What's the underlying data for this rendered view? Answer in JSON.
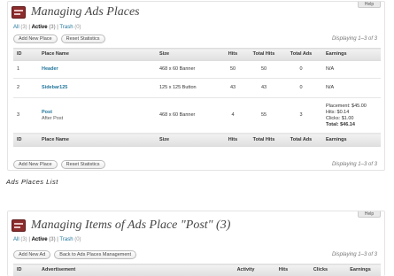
{
  "panel1": {
    "help": "Help",
    "title": "Managing Ads Places",
    "filters": {
      "all_label": "All",
      "all_count": "(3)",
      "active_label": "Active",
      "active_count": "(3)",
      "trash_label": "Trash",
      "trash_count": "(0)",
      "sep": "|"
    },
    "toolbar": {
      "add_label": "Add New Place",
      "reset_label": "Reset Statistics"
    },
    "displaying": "Displaying 1–3 of 3",
    "columns": {
      "id": "ID",
      "place": "Place Name",
      "size": "Size",
      "hits": "Hits",
      "total_hits": "Total Hits",
      "total_ads": "Total Ads",
      "earnings": "Earnings"
    },
    "rows": [
      {
        "id": "1",
        "name": "Header",
        "desc": "",
        "size": "468 x 60 Banner",
        "hits": "50",
        "total_hits": "50",
        "total_ads": "0",
        "earnings": [
          "N/A"
        ],
        "earnings_total": ""
      },
      {
        "id": "2",
        "name": "Sidebar125",
        "desc": "",
        "size": "125 x 125 Button",
        "hits": "43",
        "total_hits": "43",
        "total_ads": "0",
        "earnings": [
          "N/A"
        ],
        "earnings_total": ""
      },
      {
        "id": "3",
        "name": "Post",
        "desc": "After Post",
        "size": "468 x 60 Banner",
        "hits": "4",
        "total_hits": "55",
        "total_ads": "3",
        "earnings": [
          "Placement: $45.00",
          "Hits: $0.14",
          "Clicks: $1.00"
        ],
        "earnings_total": "Total: $46.14"
      }
    ]
  },
  "caption": "Ads Places List",
  "panel2": {
    "help": "Help",
    "title": "Managing Items of Ads Place \"Post\" (3)",
    "filters": {
      "all_label": "All",
      "all_count": "(3)",
      "active_label": "Active",
      "active_count": "(3)",
      "trash_label": "Trash",
      "trash_count": "(0)",
      "sep": "|"
    },
    "toolbar": {
      "add_label": "Add New Ad",
      "back_label": "Back to Ads Places Management"
    },
    "displaying": "Displaying 1–3 of 3",
    "columns": {
      "id": "ID",
      "ad": "Advertisement",
      "activity": "Activity",
      "hits": "Hits",
      "clicks": "Clicks",
      "earnings": "Earnings"
    }
  },
  "colors": {
    "link": "#21759b",
    "icon": "#8c2c2c"
  }
}
